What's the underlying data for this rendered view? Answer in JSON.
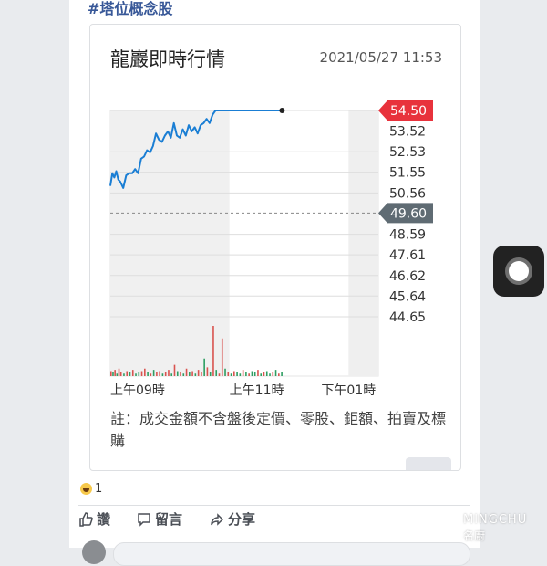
{
  "post": {
    "hashtag": "#塔位概念股"
  },
  "card": {
    "title": "龍巖即時行情",
    "timestamp": "2021/05/27 11:53",
    "note": "註：成交金額不含盤後定價、零股、鉅額、拍賣及標購"
  },
  "chart_data": {
    "type": "line",
    "title": "龍巖即時行情",
    "y_ticks": [
      "53.52",
      "52.53",
      "51.55",
      "50.56",
      "48.59",
      "47.61",
      "46.62",
      "45.64",
      "44.65"
    ],
    "current_price": "54.50",
    "reference_price": "49.60",
    "x_ticks": [
      "上午09時",
      "上午11時",
      "下午01時"
    ],
    "ylim": [
      44.65,
      54.5
    ],
    "x_range": [
      "09:00",
      "13:30"
    ],
    "price_series": {
      "x": [
        "09:00",
        "09:02",
        "09:04",
        "09:06",
        "09:08",
        "09:10",
        "09:13",
        "09:16",
        "09:19",
        "09:22",
        "09:25",
        "09:28",
        "09:31",
        "09:34",
        "09:37",
        "09:40",
        "09:43",
        "09:46",
        "09:49",
        "09:52",
        "09:55",
        "09:58",
        "10:01",
        "10:04",
        "10:07",
        "10:10",
        "10:13",
        "10:16",
        "10:19",
        "10:22",
        "10:25",
        "10:28",
        "10:31",
        "10:34",
        "10:37",
        "10:40",
        "10:43",
        "10:46",
        "10:49",
        "10:52",
        "10:55",
        "10:58",
        "11:01",
        "11:04",
        "11:07",
        "11:10",
        "11:20",
        "11:30",
        "11:40",
        "11:50",
        "11:53"
      ],
      "values": [
        50.9,
        51.5,
        51.3,
        51.6,
        51.2,
        51.1,
        50.8,
        51.4,
        51.5,
        51.5,
        51.7,
        51.5,
        52.2,
        52.3,
        52.6,
        52.5,
        52.8,
        53.4,
        53.1,
        53.0,
        53.3,
        53.5,
        53.2,
        53.9,
        53.3,
        53.2,
        53.6,
        53.3,
        53.8,
        53.5,
        53.7,
        53.4,
        53.8,
        53.9,
        54.1,
        53.9,
        54.3,
        54.5,
        54.5,
        54.5,
        54.5,
        54.5,
        54.5,
        54.5,
        54.5,
        54.5,
        54.5,
        54.5,
        54.5,
        54.5,
        54.5
      ]
    },
    "volume_series": {
      "x": [
        "09:00",
        "09:02",
        "09:04",
        "09:06",
        "09:08",
        "09:10",
        "09:13",
        "09:16",
        "09:19",
        "09:22",
        "09:25",
        "09:28",
        "09:31",
        "09:34",
        "09:37",
        "09:40",
        "09:43",
        "09:46",
        "09:49",
        "09:52",
        "09:55",
        "09:58",
        "10:01",
        "10:04",
        "10:07",
        "10:10",
        "10:13",
        "10:16",
        "10:19",
        "10:22",
        "10:25",
        "10:28",
        "10:31",
        "10:34",
        "10:37",
        "10:40",
        "10:43",
        "10:46",
        "10:49",
        "10:52",
        "10:55",
        "10:58",
        "11:01",
        "11:04",
        "11:07",
        "11:10",
        "11:13",
        "11:16",
        "11:19",
        "11:22",
        "11:25",
        "11:28",
        "11:31",
        "11:34",
        "11:37",
        "11:40",
        "11:43",
        "11:46",
        "11:49",
        "11:52"
      ],
      "values": [
        4,
        3,
        5,
        2,
        6,
        3,
        2,
        4,
        3,
        5,
        2,
        3,
        4,
        6,
        3,
        2,
        5,
        3,
        4,
        2,
        3,
        5,
        2,
        9,
        4,
        3,
        2,
        6,
        3,
        4,
        2,
        5,
        3,
        14,
        7,
        3,
        40,
        5,
        2,
        30,
        6,
        3,
        2,
        4,
        3,
        2,
        5,
        3,
        2,
        4,
        3,
        5,
        2,
        3,
        4,
        2,
        3,
        5,
        2,
        3
      ],
      "up": [
        1,
        0,
        1,
        0,
        1,
        1,
        0,
        1,
        0,
        1,
        0,
        0,
        1,
        1,
        0,
        1,
        0,
        1,
        1,
        0,
        1,
        1,
        0,
        1,
        0,
        1,
        0,
        1,
        0,
        1,
        0,
        1,
        1,
        0,
        1,
        0,
        1,
        0,
        1,
        1,
        0,
        1,
        0,
        1,
        0,
        0,
        1,
        0,
        1,
        0,
        0,
        1,
        0,
        1,
        0,
        0,
        1,
        0,
        1,
        0
      ]
    },
    "colors": {
      "line": "#1a7ed4",
      "up": "#d9534f",
      "down": "#2e9e62",
      "current_label": "#e8323c",
      "reference_label": "#5f6b73"
    },
    "grid": true
  },
  "reactions": {
    "count": "1"
  },
  "actions": [
    {
      "label": "讚",
      "icon": "thumbs-up-icon"
    },
    {
      "label": "留言",
      "icon": "comment-icon"
    },
    {
      "label": "分享",
      "icon": "share-icon"
    }
  ],
  "watermark": {
    "en": "MINGCHU",
    "zh": "名廚"
  }
}
